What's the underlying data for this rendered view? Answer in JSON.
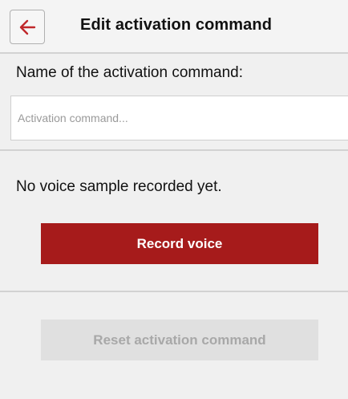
{
  "header": {
    "back_icon": "arrow-left-icon",
    "title": "Edit activation command"
  },
  "form": {
    "name_label": "Name of the activation command:",
    "name_value": "",
    "name_placeholder": "Activation command..."
  },
  "voice": {
    "status": "No voice sample recorded yet.",
    "record_label": "Record voice"
  },
  "reset": {
    "label": "Reset activation command",
    "enabled": false
  },
  "colors": {
    "accent": "#a61b1b",
    "background": "#f0f0f0",
    "disabled_bg": "#e0e0e0",
    "disabled_text": "#a8a8a8"
  }
}
